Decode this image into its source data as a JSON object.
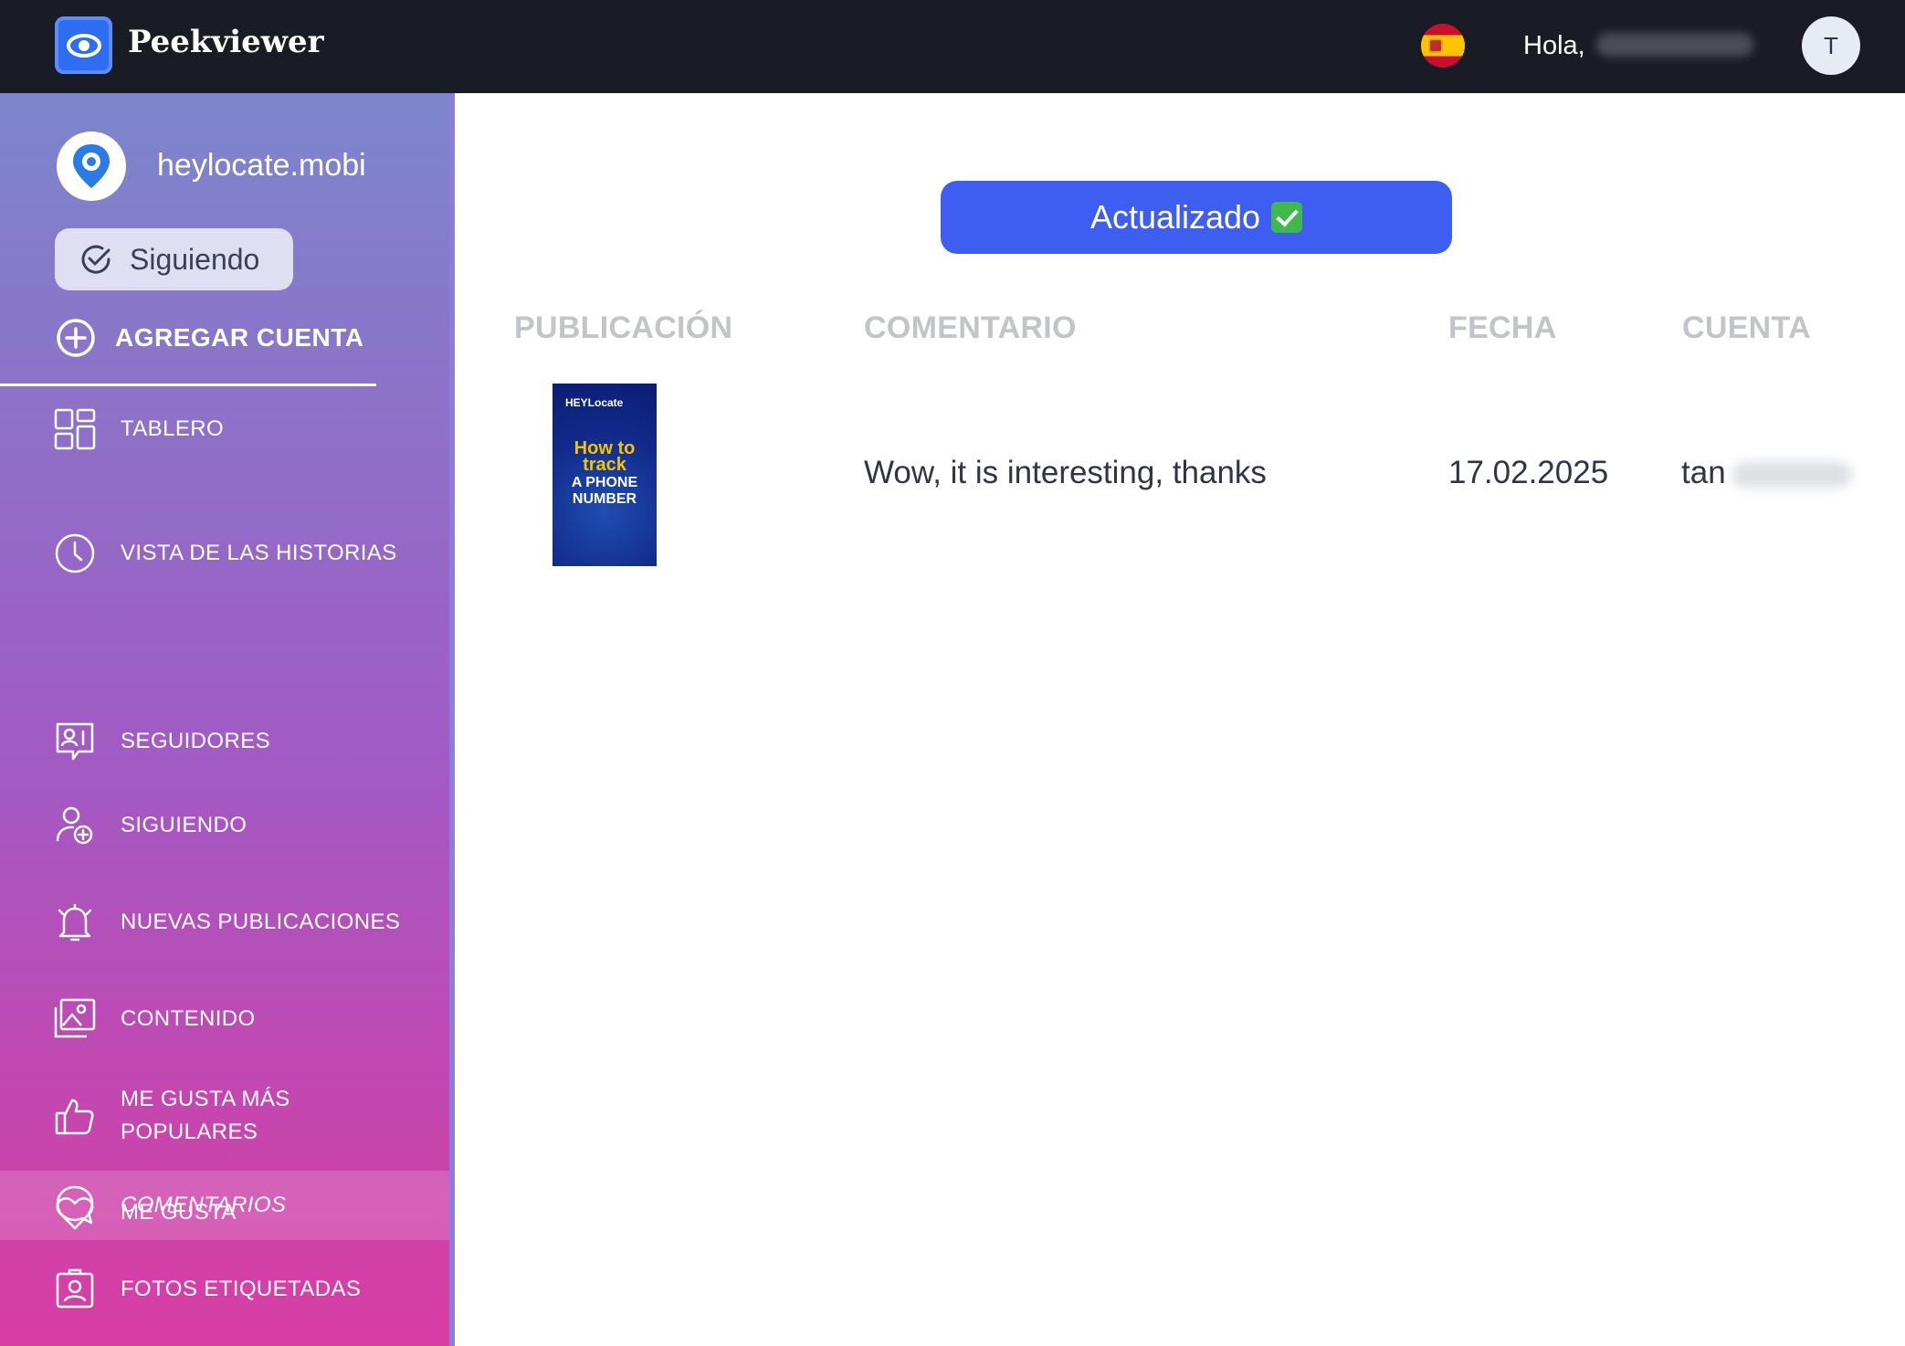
{
  "topbar": {
    "brand": "Peekviewer",
    "greeting": "Hola,",
    "avatar_initial": "T"
  },
  "sidebar": {
    "account_name": "heylocate.mobi",
    "following_button": "Siguiendo",
    "add_account": "AGREGAR CUENTA",
    "items": [
      {
        "label": "TABLERO",
        "icon": "dashboard-icon"
      },
      {
        "label": "VISTA DE LAS HISTORIAS",
        "icon": "clock-icon"
      },
      {
        "label": "SEGUIDORES",
        "icon": "followers-icon"
      },
      {
        "label": "SIGUIENDO",
        "icon": "user-plus-icon"
      },
      {
        "label": "NUEVAS PUBLICACIONES",
        "icon": "bell-icon"
      },
      {
        "label": "CONTENIDO",
        "icon": "images-icon"
      },
      {
        "label": "ME GUSTA MÁS POPULARES",
        "icon": "thumbs-up-icon"
      },
      {
        "label": "ME GUSTA",
        "icon": "heart-icon"
      },
      {
        "label": "COMENTARIOS",
        "icon": "comment-icon",
        "active": true
      },
      {
        "label": "FOTOS ETIQUETADAS",
        "icon": "tagged-photo-icon"
      }
    ]
  },
  "main": {
    "update_button": "Actualizado",
    "table": {
      "headers": [
        "PUBLICACIÓN",
        "COMENTARIO",
        "FECHA",
        "CUENTA"
      ],
      "rows": [
        {
          "thumbnail": {
            "brand": "HEYLocate",
            "line1": "How to track",
            "line2": "A PHONE NUMBER"
          },
          "comment": "Wow, it is interesting, thanks",
          "date": "17.02.2025",
          "account_visible": "tan"
        }
      ]
    }
  },
  "colors": {
    "topbar_bg": "#1a1c25",
    "accent": "#3d5ef0",
    "sidebar_gradient_top": "#7c86cc",
    "sidebar_gradient_bottom": "#d93ea4"
  }
}
